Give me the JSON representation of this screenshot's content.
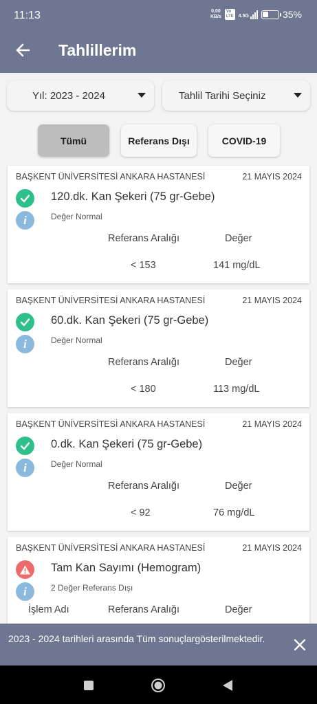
{
  "status_bar": {
    "time": "11:13",
    "net_speed_value": "0,00",
    "net_speed_unit": "KB/s",
    "volte_top": "Vo",
    "volte_bottom": "LTE",
    "network": "4.5G",
    "battery": "35%",
    "battery_level": 0.35
  },
  "app_bar": {
    "title": "Tahlillerim",
    "back_icon": "arrow-left-icon"
  },
  "filters": {
    "year_label": "Yıl: 2023 - 2024",
    "date_label": "Tahlil Tarihi Seçiniz"
  },
  "tabs": [
    {
      "label": "Tümü",
      "selected": true
    },
    {
      "label": "Referans Dışı",
      "selected": false
    },
    {
      "label": "COVID-19",
      "selected": false
    }
  ],
  "results": [
    {
      "hospital": "BAŞKENT ÜNİVERSİTESİ ANKARA HASTANESİ",
      "date": "21 MAYIS 2024",
      "status": "normal",
      "test_name": "120.dk. Kan Şekeri (75 gr-Gebe)",
      "result_status": "Değer Normal",
      "ref_header": "Referans Aralığı",
      "value_header": "Değer",
      "ref_range": "< 153",
      "value": "141 mg/dL"
    },
    {
      "hospital": "BAŞKENT ÜNİVERSİTESİ ANKARA HASTANESİ",
      "date": "21 MAYIS 2024",
      "status": "normal",
      "test_name": "60.dk. Kan Şekeri (75 gr-Gebe)",
      "result_status": "Değer Normal",
      "ref_header": "Referans Aralığı",
      "value_header": "Değer",
      "ref_range": "< 180",
      "value": "113 mg/dL"
    },
    {
      "hospital": "BAŞKENT ÜNİVERSİTESİ ANKARA HASTANESİ",
      "date": "21 MAYIS 2024",
      "status": "normal",
      "test_name": "0.dk. Kan Şekeri (75 gr-Gebe)",
      "result_status": "Değer Normal",
      "ref_header": "Referans Aralığı",
      "value_header": "Değer",
      "ref_range": "< 92",
      "value": "76 mg/dL"
    },
    {
      "hospital": "BAŞKENT ÜNİVERSİTESİ ANKARA HASTANESİ",
      "date": "21 MAYIS 2024",
      "status": "warning",
      "test_name": "Tam Kan Sayımı (Hemogram)",
      "result_status": "2 Değer Referans Dışı",
      "process_header": "İşlem Adı",
      "ref_header": "Referans Aralığı",
      "value_header": "Değer"
    }
  ],
  "snackbar": {
    "message": "2023 - 2024 tarihleri arasında Tüm sonuçlargösterilmektedir.",
    "close_icon": "close-icon"
  },
  "nav_bar": {
    "icons": [
      "recents-square-icon",
      "home-circle-icon",
      "back-triangle-icon"
    ]
  },
  "colors": {
    "primary": "#6e7691",
    "ok_green": "#2ec08b",
    "warn_red": "#ec6a6a",
    "info_blue": "#8bb9dd"
  }
}
